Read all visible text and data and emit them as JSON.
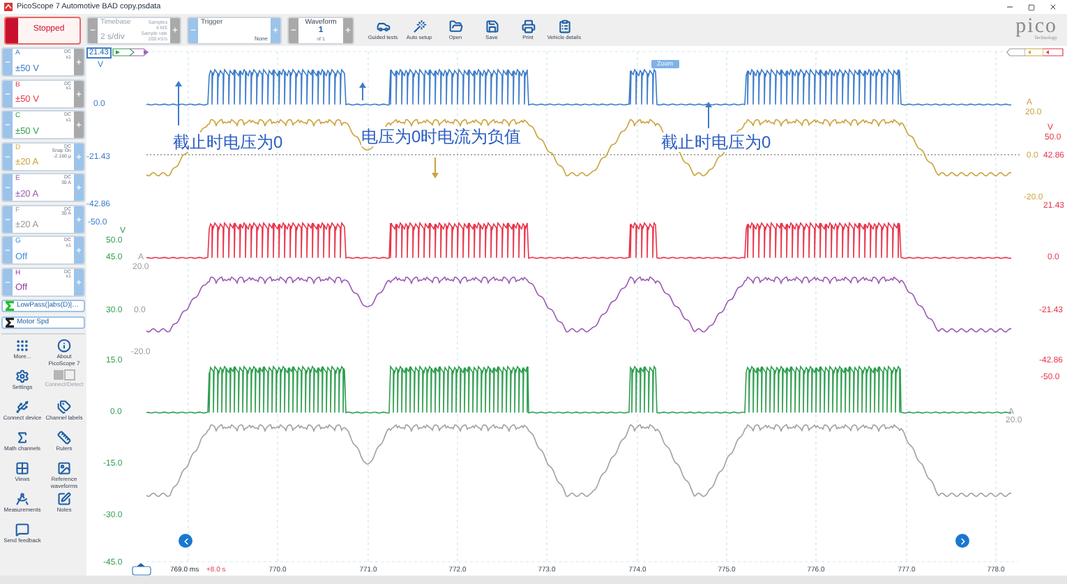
{
  "window": {
    "title": "PicoScope 7 Automotive BAD copy.psdata"
  },
  "toolbar": {
    "run_button": {
      "label": "Stopped",
      "stopped": true
    },
    "timebase": {
      "label": "Timebase",
      "value": "2 s/div",
      "samples_label": "Samples",
      "samples": "4 MS",
      "rate_label": "Sample rate",
      "rate": "200 kS/s",
      "disabled": true
    },
    "trigger": {
      "label": "Trigger",
      "mode": "None"
    },
    "waveform": {
      "label": "Waveform",
      "value": "1",
      "of": "of 1"
    },
    "tools": [
      "Guided tests",
      "Auto setup",
      "Open",
      "Save",
      "Print",
      "Vehicle details"
    ],
    "logo": {
      "name": "pico",
      "tagline": "Technology"
    }
  },
  "channels": [
    {
      "name": "A",
      "coupling": "DC",
      "probe": "x1",
      "range": "±50 V",
      "color": "#3d7cc9",
      "plus_enabled": false
    },
    {
      "name": "B",
      "coupling": "DC",
      "probe": "x1",
      "range": "±50 V",
      "color": "#e8344a",
      "plus_enabled": false
    },
    {
      "name": "C",
      "coupling": "DC",
      "probe": "x1",
      "range": "±50 V",
      "color": "#2e9e4f",
      "plus_enabled": false
    },
    {
      "name": "D",
      "coupling": "DC",
      "probe": "Snap On",
      "extra": "-2.160 µ",
      "range": "±20 A",
      "color": "#c9a23a",
      "plus_enabled": true
    },
    {
      "name": "E",
      "coupling": "DC",
      "probe": "30 A",
      "range": "±20 A",
      "color": "#9b59b6",
      "plus_enabled": true
    },
    {
      "name": "F",
      "coupling": "DC",
      "probe": "30 A",
      "range": "±20 A",
      "color": "#9a9a9a",
      "plus_enabled": true
    },
    {
      "name": "G",
      "coupling": "DC",
      "probe": "x1",
      "range": "Off",
      "color": "#3a8fd8",
      "plus_enabled": true
    },
    {
      "name": "H",
      "coupling": "DC",
      "probe": "x1",
      "range": "Off",
      "color": "#8e3a9e",
      "plus_enabled": true
    }
  ],
  "math_channels": [
    {
      "label": "LowPass(|abs(D)|…",
      "color": "#22c322"
    },
    {
      "label": "Motor Spd",
      "color": "#222222"
    }
  ],
  "sidebar_tools": [
    {
      "label": "More...",
      "disabled": false
    },
    {
      "label": "About PicoScope 7",
      "disabled": false
    },
    {
      "label": "Settings",
      "disabled": false
    },
    {
      "label": "Connect/Detect",
      "disabled": true
    },
    {
      "label": "Connect device",
      "disabled": false
    },
    {
      "label": "Channel labels",
      "disabled": false
    },
    {
      "label": "Math channels",
      "disabled": false
    },
    {
      "label": "Rulers",
      "disabled": false
    },
    {
      "label": "Views",
      "disabled": false
    },
    {
      "label": "Reference waveforms",
      "disabled": false
    },
    {
      "label": "Measurements",
      "disabled": false
    },
    {
      "label": "Notes",
      "disabled": false
    },
    {
      "label": "Send feedback",
      "disabled": false
    }
  ],
  "plot": {
    "axis_handle": "21.43",
    "zoom_badge": "Zoom",
    "axes": [
      {
        "color": "#3d7cc9",
        "labels": [
          "V",
          "0.0",
          "-21.43",
          "-42.86",
          "-50.0"
        ]
      },
      {
        "color": "#2e9e4f",
        "labels": [
          "V",
          "50.0",
          "45.0",
          "30.0",
          "15.0",
          "0.0",
          "-15.0",
          "-30.0",
          "-45.0"
        ]
      },
      {
        "color": "#9a9a9a",
        "labels": [
          "A",
          "20.0",
          "0.0",
          "-20.0"
        ]
      },
      {
        "color": "#c9a23a",
        "labels": [
          "A",
          "20.0",
          "0.0",
          "-20.0"
        ]
      },
      {
        "color": "#e8344a",
        "labels": [
          "V",
          "50.0",
          "42.86",
          "21.43",
          "0.0",
          "-21.43",
          "-42.86",
          "-50.0"
        ]
      },
      {
        "color": "#9a9a9a",
        "labels": [
          "A",
          "20.0"
        ]
      }
    ],
    "traces": [
      {
        "kind": "pulse",
        "color": "#3d7cc9"
      },
      {
        "kind": "smooth",
        "color": "#c9a23a"
      },
      {
        "kind": "pulse",
        "color": "#e8344a"
      },
      {
        "kind": "smooth",
        "color": "#9b59b6"
      },
      {
        "kind": "pulse",
        "color": "#2e9e4f"
      },
      {
        "kind": "smooth",
        "color": "#a0a0a0"
      }
    ],
    "annotations": [
      {
        "text": "截止时电压为0"
      },
      {
        "text": "电压为0时电流为负值"
      },
      {
        "text": "截止时电压为0"
      }
    ],
    "time_axis": {
      "start": "769.0 ms",
      "offset": "+8.0 s",
      "ticks": [
        "770.0",
        "771.0",
        "772.0",
        "773.0",
        "774.0",
        "775.0",
        "776.0",
        "777.0",
        "778.0"
      ]
    }
  }
}
